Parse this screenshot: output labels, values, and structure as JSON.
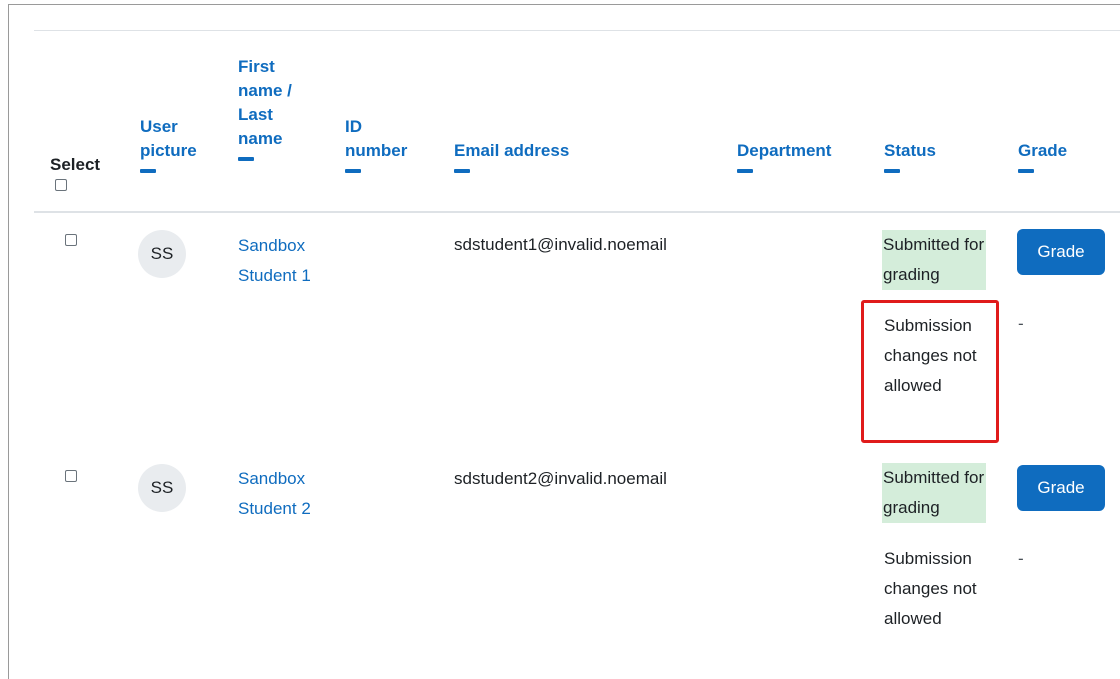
{
  "headers": {
    "select": "Select",
    "user_picture": "User picture",
    "name": "First name / Last name",
    "id_number": "ID number",
    "email": "Email address",
    "department": "Department",
    "status": "Status",
    "grade": "Grade"
  },
  "rows": [
    {
      "initials": "SS",
      "name": "Sandbox Student 1",
      "email": "sdstudent1@invalid.noemail",
      "status_submitted": "Submitted for grading",
      "status_changes": "Submission changes not allowed",
      "grade_button": "Grade",
      "grade_value": "-",
      "highlighted": true
    },
    {
      "initials": "SS",
      "name": "Sandbox Student 2",
      "email": "sdstudent2@invalid.noemail",
      "status_submitted": "Submitted for grading",
      "status_changes": "Submission changes not allowed",
      "grade_button": "Grade",
      "grade_value": "-",
      "highlighted": false
    }
  ],
  "colors": {
    "link": "#0f6cbf",
    "submitted_bg": "#d4edda",
    "highlight": "#e01b1b"
  }
}
